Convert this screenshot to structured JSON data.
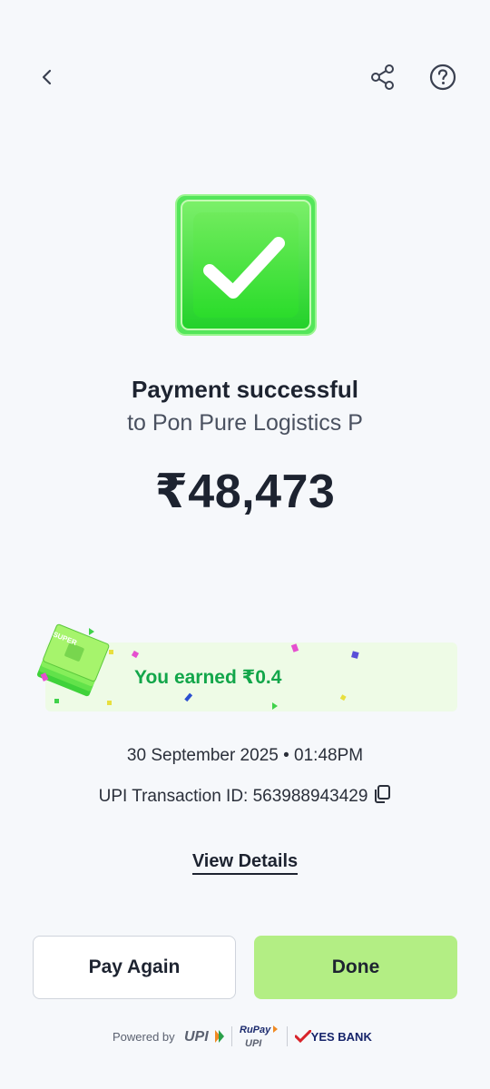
{
  "header": {
    "back_icon": "chevron-left-icon",
    "share_icon": "share-icon",
    "help_icon": "help-circle-icon"
  },
  "status": {
    "title": "Payment successful",
    "recipient": "to Pon Pure Logistics P",
    "amount": "₹48,473",
    "badge_color": "#3be33b"
  },
  "reward": {
    "text": "You earned ₹0.4",
    "card_label": "SUPER"
  },
  "details": {
    "date_time": "30 September 2025 • 01:48PM",
    "transaction_id": "UPI Transaction ID: 563988943429",
    "view_details": "View Details"
  },
  "actions": {
    "pay_again": "Pay Again",
    "done": "Done",
    "done_color": "#b3ee84"
  },
  "footer": {
    "powered_by": "Powered by",
    "upi_logo": "UPI",
    "rupay_logo": "RuPay",
    "rupay_upi": "UPI",
    "bank": "YES BANK"
  }
}
